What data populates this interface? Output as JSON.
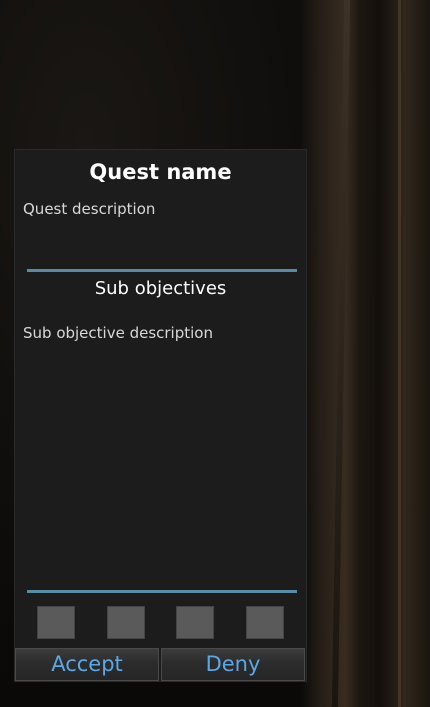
{
  "quest": {
    "name": "Quest name",
    "description": "Quest description",
    "sub_title": "Sub objectives",
    "sub_description": "Sub objective description"
  },
  "rewards": {
    "slots": [
      "",
      "",
      "",
      ""
    ]
  },
  "buttons": {
    "accept_label": "Accept",
    "deny_label": "Deny"
  },
  "colors": {
    "panel_bg": "#1c1c1c",
    "divider": "#5b8aa6",
    "button_text": "#5aa8e6",
    "slot": "#5a5a5a"
  }
}
